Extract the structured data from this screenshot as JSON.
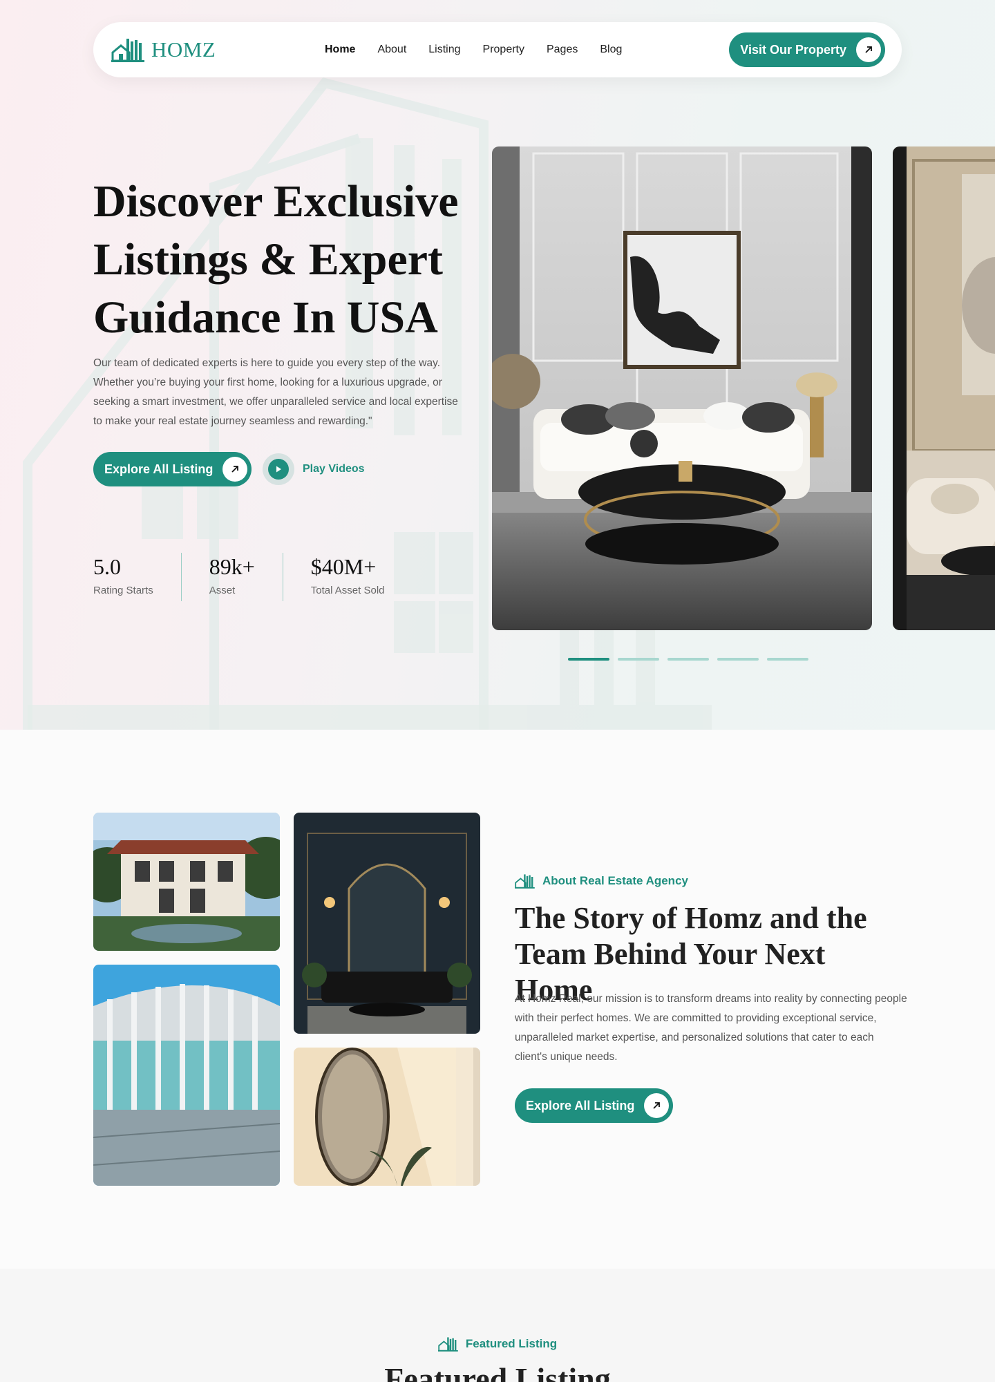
{
  "brand": {
    "name": "HOMZ",
    "accent": "#1f8f7f"
  },
  "nav": {
    "links": [
      "Home",
      "About",
      "Listing",
      "Property",
      "Pages",
      "Blog"
    ],
    "active": "Home",
    "cta_label": "Visit Our Property"
  },
  "hero": {
    "title": "Discover Exclusive Listings & Expert Guidance In USA",
    "description": "Our team of dedicated experts is here to guide you every step of the way. Whether you’re buying your first home, looking for a luxurious upgrade, or seeking a smart investment, we offer unparalleled service and local expertise to make your real estate journey seamless and rewarding.\"",
    "cta_label": "Explore All Listing",
    "play_label": "Play Videos",
    "stats": [
      {
        "value": "5.0",
        "label": "Rating Starts"
      },
      {
        "value": "89k+",
        "label": "Asset"
      },
      {
        "value": "$40M+",
        "label": "Total Asset Sold"
      }
    ],
    "slider": {
      "count": 5,
      "active_index": 0
    }
  },
  "about": {
    "tagline": "About Real Estate Agency",
    "title": "The Story of Homz and the Team Behind Your Next Home",
    "description": "At Homz Real, our mission is to transform dreams into reality by connecting people with their perfect homes. We are committed to providing exceptional service, unparalleled market expertise, and personalized solutions that cater to each client's unique needs.",
    "cta_label": "Explore All Listing"
  },
  "featured": {
    "tagline": "Featured Listing",
    "title": "Featured Listing"
  },
  "icons": [
    "house-logo-icon",
    "arrow-up-right-icon",
    "play-icon"
  ]
}
